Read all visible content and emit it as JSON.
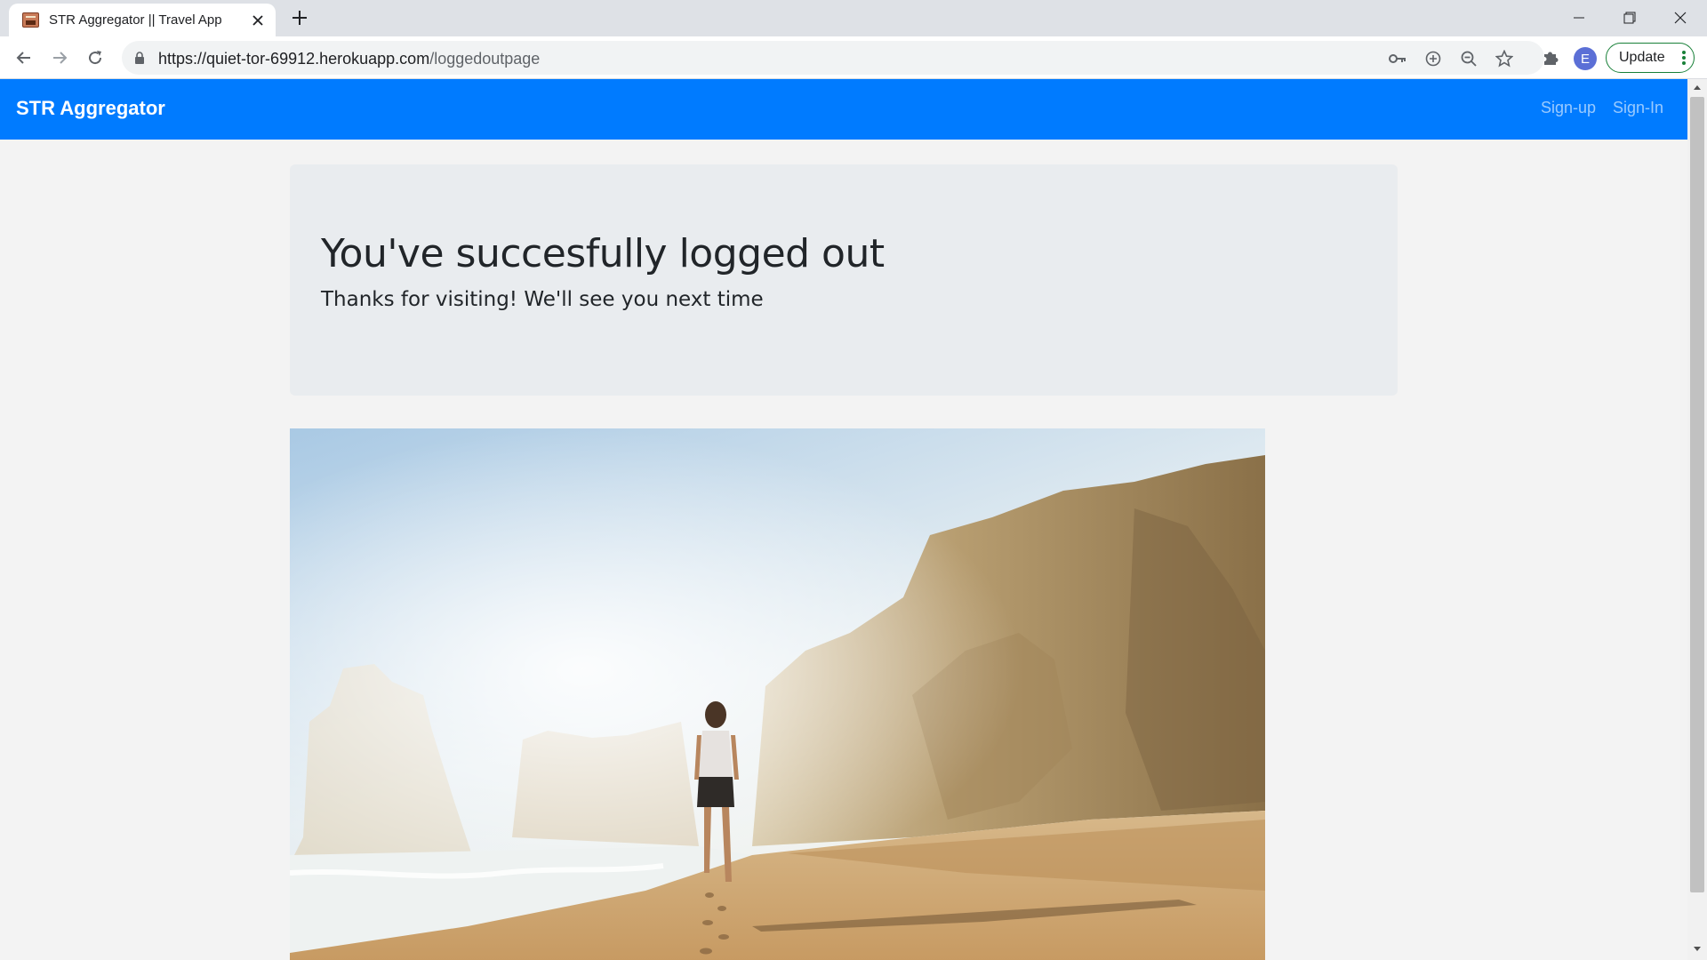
{
  "browser": {
    "tab_title": "STR Aggregator || Travel App",
    "url_host": "https://quiet-tor-69912.herokuapp.com",
    "url_path": "/loggedoutpage",
    "profile_initial": "E",
    "update_label": "Update"
  },
  "navbar": {
    "brand": "STR Aggregator",
    "links": [
      {
        "label": "Sign-up"
      },
      {
        "label": "Sign-In"
      }
    ]
  },
  "jumbotron": {
    "heading": "You've succesfully logged out",
    "subheading": "Thanks for visiting! We'll see you next time"
  },
  "colors": {
    "navbar_bg": "#007bff",
    "jumbotron_bg": "#e9ecef",
    "update_border": "#188038"
  },
  "icons": {
    "back": "arrow-left-icon",
    "forward": "arrow-right-icon",
    "reload": "reload-icon",
    "lock": "lock-icon",
    "key": "key-icon",
    "install": "install-icon",
    "zoom": "zoom-out-icon",
    "star": "star-icon",
    "extensions": "puzzle-icon"
  }
}
